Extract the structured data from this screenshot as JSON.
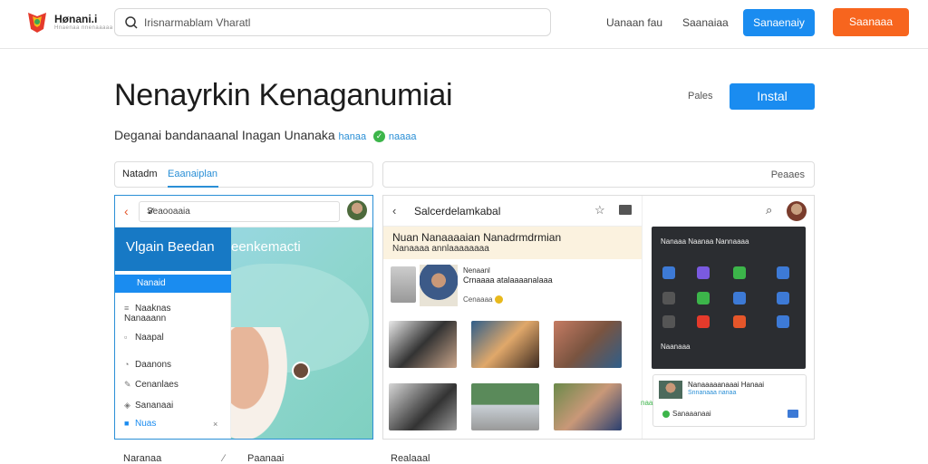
{
  "header": {
    "brand": "Hønani.i",
    "brand_sub": "Hnaenaa nnenaaaaa",
    "search_placeholder": "Irisnarmablam Vharatl",
    "nav": [
      "Uanaan fau",
      "Saanaiaa"
    ],
    "blue_button": "Sanaenaiy",
    "orange_button": "Saanaaa"
  },
  "app": {
    "title": "Nenayrkin Kenaganumiai",
    "subtitle": "Deganai bandanaanal Inagan Unanaka",
    "subtitle_link": "hanaa",
    "subtitle_tag": "naaaa",
    "ratings_label": "Pales",
    "install_label": "Instal"
  },
  "tabs": {
    "left_first": "Natadm",
    "left_second": "Eaanaiplan",
    "right_label": "Peaaes"
  },
  "screenshot_left": {
    "search_text": "Seaooaaia",
    "map_title": "Vlgain Beedan",
    "map_title_suffix": "eenkemacti",
    "menu_active": "Nanaid",
    "menu_items": [
      {
        "icon": "sliders-icon",
        "label": "Naaknas\nNanaaann"
      },
      {
        "icon": "doc-icon",
        "label": "Naapal"
      },
      {
        "icon": "clock-icon",
        "label": "Daanons"
      },
      {
        "icon": "pencil-icon",
        "label": "Cenanlaes"
      },
      {
        "icon": "settings-icon",
        "label": "Sananaai"
      },
      {
        "icon": "box-icon",
        "label": "Nuas",
        "active": true
      }
    ]
  },
  "screenshot_right": {
    "title": "Salcerdelamkabal",
    "banner_title": "Nuan Nanaaaaian Nanadrmdrmian",
    "banner_sub": "Nanaaaa annlaaaaaaaa",
    "post_line1": "Nenaanl",
    "post_line2": "Crnaaaa atalaaaanalaaa",
    "post_line3": "Cenaaaa",
    "phone_header": "Nanaaa Naanaa Nannaaaa",
    "phone_label": "Naanaaa",
    "card_title": "Nanaaaaanaaai Hanaai",
    "card_sub": "Snnanaaa nanaa",
    "card_action": "Sanaaanaai",
    "card_prefix": "naa"
  },
  "footer": [
    "Naranaa",
    "Paanaai",
    "Realaaal"
  ],
  "colors": {
    "accent_blue": "#1a8cf0",
    "accent_orange": "#f7651e",
    "verified_green": "#3cb54a",
    "banner_bg": "#fbf2df"
  }
}
